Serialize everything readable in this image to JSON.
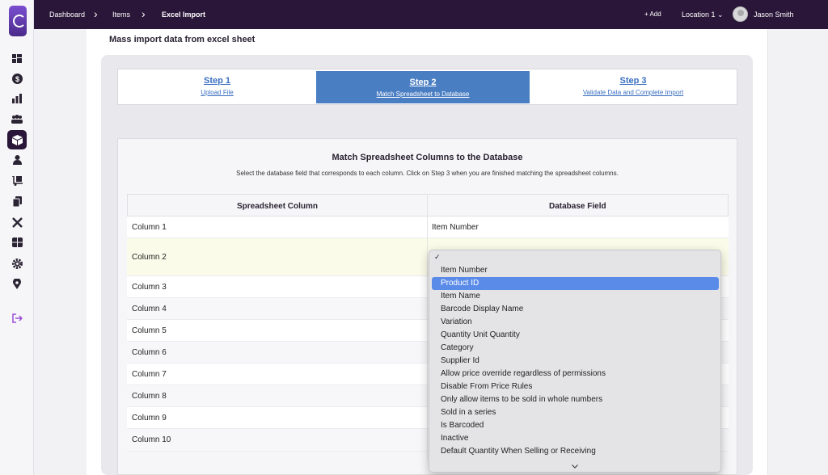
{
  "topbar": {
    "breadcrumbs": [
      "Dashboard",
      "Items",
      "Excel Import"
    ],
    "add_label": "+ Add",
    "location_label": "Location 1 ⌄",
    "user_name": "Jason Smith"
  },
  "page": {
    "title": "Mass import data from excel sheet"
  },
  "steps": [
    {
      "title": "Step 1",
      "subtitle": "Upload File"
    },
    {
      "title": "Step 2",
      "subtitle": "Match Spreadsheet to Database"
    },
    {
      "title": "Step 3",
      "subtitle": "Validate Data and Complete Import"
    }
  ],
  "card": {
    "title": "Match Spreadsheet Columns to the Database",
    "subtitle": "Select the database field that corresponds to each column. Click on Step 3 when you are finished matching the spreadsheet columns."
  },
  "table": {
    "headers": [
      "Spreadsheet Column",
      "Database Field"
    ],
    "rows": [
      {
        "column": "Column 1",
        "field": "Item Number"
      },
      {
        "column": "Column 2",
        "field": ""
      },
      {
        "column": "Column 3",
        "field": ""
      },
      {
        "column": "Column 4",
        "field": ""
      },
      {
        "column": "Column 5",
        "field": ""
      },
      {
        "column": "Column 6",
        "field": ""
      },
      {
        "column": "Column 7",
        "field": ""
      },
      {
        "column": "Column 8",
        "field": ""
      },
      {
        "column": "Column 9",
        "field": ""
      },
      {
        "column": "Column 10",
        "field": ""
      }
    ]
  },
  "dropdown": {
    "check": "✓",
    "options": [
      "Item Number",
      "Product ID",
      "Item Name",
      "Barcode Display Name",
      "Variation",
      "Quantity Unit Quantity",
      "Category",
      "Supplier Id",
      "Allow price override regardless of permissions",
      "Disable From Price Rules",
      "Only allow items to be sold in whole numbers",
      "Sold in a series",
      "Is Barcoded",
      "Inactive",
      "Default Quantity When Selling or Receiving"
    ],
    "selected": "Product ID",
    "scroll_icon": "chevron-down-icon"
  },
  "sidebar_icons": [
    "dashboard-icon",
    "dollar-icon",
    "chart-icon",
    "people-icon",
    "box-icon",
    "user-icon",
    "dolly-icon",
    "copy-icon",
    "tools-icon",
    "calculator-icon",
    "gear-icon",
    "location-pin-icon",
    "logout-icon"
  ],
  "colors": {
    "topbar": "#2a1638",
    "accent": "#4a7ec3",
    "selected": "#5b8be8"
  }
}
